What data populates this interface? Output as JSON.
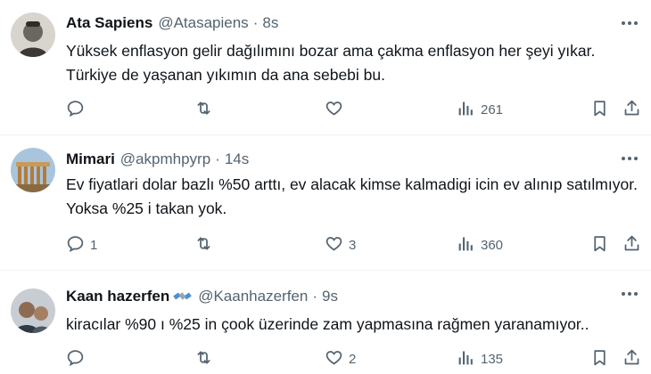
{
  "tweets": [
    {
      "display_name": "Ata Sapiens",
      "handle": "@Atasapiens",
      "separator": "·",
      "time": "8s",
      "text": "Yüksek enflasyon gelir dağılımını bozar ama çakma enflasyon her şeyi yıkar. Türkiye de yaşanan yıkımın da  ana sebebi bu.",
      "replies": "",
      "retweets": "",
      "likes": "",
      "views": "261"
    },
    {
      "display_name": "Mimari",
      "handle": "@akpmhpyrp",
      "separator": "·",
      "time": "14s",
      "text": "Ev fiyatlari dolar bazlı %50 arttı, ev alacak kimse kalmadigi icin ev alınıp satılmıyor. Yoksa %25 i takan yok.",
      "replies": "1",
      "retweets": "",
      "likes": "3",
      "views": "360"
    },
    {
      "display_name": "Kaan hazerfen",
      "handle": "@Kaanhazerfen",
      "separator": "·",
      "time": "9s",
      "text": "kiracılar %90 ı %25 in çook üzerinde zam yapmasına rağmen yaranamıyor..",
      "replies": "",
      "retweets": "",
      "likes": "2",
      "views": "135"
    }
  ],
  "icons": {
    "reply": "reply-icon",
    "retweet": "retweet-icon",
    "like": "heart-icon",
    "views": "views-icon",
    "bookmark": "bookmark-icon",
    "share": "share-icon",
    "more": "more-icon",
    "badge": "satellite-emoji"
  },
  "colors": {
    "text_primary": "#0f1419",
    "text_secondary": "#536471",
    "divider": "#eff3f4"
  }
}
